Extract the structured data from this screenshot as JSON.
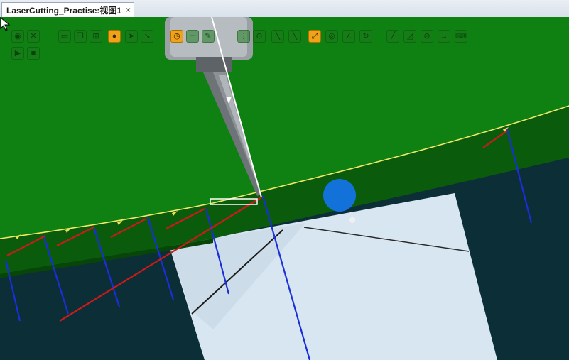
{
  "tab": {
    "title": "LaserCutting_Practise:视图1",
    "close_glyph": "×"
  },
  "toolbar": {
    "row1": [
      {
        "icon": "select-icon"
      },
      {
        "icon": "fit-view-icon"
      },
      {
        "icon": "frame-icon"
      },
      {
        "icon": "copy-icon"
      },
      {
        "icon": "frame-plus-icon"
      },
      {
        "icon": "sphere-view-icon"
      },
      {
        "icon": "arrow-icon"
      },
      {
        "icon": "arrow-alt-icon"
      },
      {
        "icon": "clock-icon"
      },
      {
        "icon": "h-measure-icon"
      },
      {
        "icon": "pencil-icon"
      },
      {
        "icon": "grid-icon"
      },
      {
        "icon": "target-icon"
      },
      {
        "icon": "line-icon"
      },
      {
        "icon": "diagonal-icon"
      },
      {
        "icon": "curve-edit-icon"
      },
      {
        "icon": "circle-icon"
      },
      {
        "icon": "angle-icon"
      },
      {
        "icon": "rotate-icon"
      },
      {
        "icon": "slash-icon"
      },
      {
        "icon": "shear-icon"
      },
      {
        "icon": "no-entry-icon"
      },
      {
        "icon": "arrow-right-icon"
      },
      {
        "icon": "keyboard-icon"
      }
    ],
    "row2": [
      {
        "icon": "play-icon"
      },
      {
        "icon": "stop-icon"
      }
    ]
  },
  "colors": {
    "plate_top": "#0f8012",
    "plate_edge": "#0a5c0c",
    "background": "#0b2e37",
    "floor": "#d8e6f2",
    "path_line": "#f2e86a",
    "normal_line": "#1a2fd8",
    "approach_line": "#cc1a1a",
    "cursor": "#1473e6"
  }
}
